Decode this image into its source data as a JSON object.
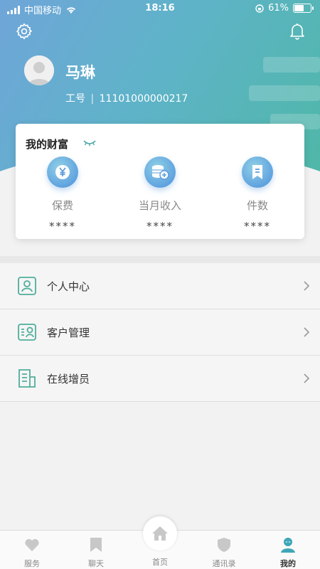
{
  "status": {
    "carrier": "中国移动",
    "time": "18:16",
    "battery": "61%"
  },
  "profile": {
    "name": "马琳",
    "employee_label": "工号",
    "employee_id": "11101000000217"
  },
  "wealth": {
    "title": "我的财富",
    "items": [
      {
        "label": "保费",
        "value": "****",
        "icon": "yuan-icon"
      },
      {
        "label": "当月收入",
        "value": "****",
        "icon": "coins-icon"
      },
      {
        "label": "件数",
        "value": "****",
        "icon": "bookmark-icon"
      }
    ]
  },
  "menu": [
    {
      "label": "个人中心",
      "icon": "person-card-icon"
    },
    {
      "label": "客户管理",
      "icon": "customer-card-icon"
    },
    {
      "label": "在线增员",
      "icon": "document-icon"
    }
  ],
  "tabs": [
    {
      "label": "服务",
      "icon": "heart-icon"
    },
    {
      "label": "聊天",
      "icon": "bookmark-icon"
    },
    {
      "label": "首页",
      "icon": "home-icon"
    },
    {
      "label": "通讯录",
      "icon": "shield-icon"
    },
    {
      "label": "我的",
      "icon": "user-icon",
      "active": true
    }
  ],
  "colors": {
    "accent": "#4fb7a7",
    "brand_blue": "#5a9cde",
    "tab_active": "#3fa6b8"
  }
}
